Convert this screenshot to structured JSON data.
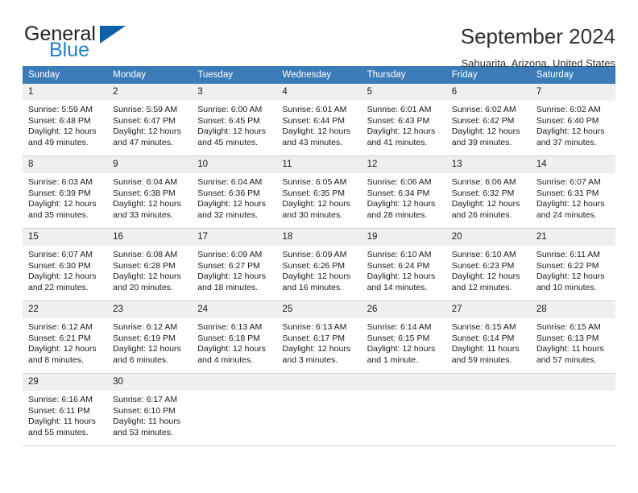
{
  "logo": {
    "word_one": "General",
    "word_two": "Blue",
    "triangle_color": "#1060a8",
    "blue_color": "#1f7fc4"
  },
  "header": {
    "title": "September 2024",
    "subtitle": "Sahuarita, Arizona, United States"
  },
  "theme": {
    "header_bg": "#3b7cb8",
    "header_text": "#ffffff",
    "daynum_bg": "#efefef",
    "cell_border": "#d2d2d2"
  },
  "weekday_headers": [
    "Sunday",
    "Monday",
    "Tuesday",
    "Wednesday",
    "Thursday",
    "Friday",
    "Saturday"
  ],
  "weeks": [
    [
      {
        "day": "1",
        "sunrise": "Sunrise: 5:59 AM",
        "sunset": "Sunset: 6:48 PM",
        "daylight_1": "Daylight: 12 hours",
        "daylight_2": "and 49 minutes."
      },
      {
        "day": "2",
        "sunrise": "Sunrise: 5:59 AM",
        "sunset": "Sunset: 6:47 PM",
        "daylight_1": "Daylight: 12 hours",
        "daylight_2": "and 47 minutes."
      },
      {
        "day": "3",
        "sunrise": "Sunrise: 6:00 AM",
        "sunset": "Sunset: 6:45 PM",
        "daylight_1": "Daylight: 12 hours",
        "daylight_2": "and 45 minutes."
      },
      {
        "day": "4",
        "sunrise": "Sunrise: 6:01 AM",
        "sunset": "Sunset: 6:44 PM",
        "daylight_1": "Daylight: 12 hours",
        "daylight_2": "and 43 minutes."
      },
      {
        "day": "5",
        "sunrise": "Sunrise: 6:01 AM",
        "sunset": "Sunset: 6:43 PM",
        "daylight_1": "Daylight: 12 hours",
        "daylight_2": "and 41 minutes."
      },
      {
        "day": "6",
        "sunrise": "Sunrise: 6:02 AM",
        "sunset": "Sunset: 6:42 PM",
        "daylight_1": "Daylight: 12 hours",
        "daylight_2": "and 39 minutes."
      },
      {
        "day": "7",
        "sunrise": "Sunrise: 6:02 AM",
        "sunset": "Sunset: 6:40 PM",
        "daylight_1": "Daylight: 12 hours",
        "daylight_2": "and 37 minutes."
      }
    ],
    [
      {
        "day": "8",
        "sunrise": "Sunrise: 6:03 AM",
        "sunset": "Sunset: 6:39 PM",
        "daylight_1": "Daylight: 12 hours",
        "daylight_2": "and 35 minutes."
      },
      {
        "day": "9",
        "sunrise": "Sunrise: 6:04 AM",
        "sunset": "Sunset: 6:38 PM",
        "daylight_1": "Daylight: 12 hours",
        "daylight_2": "and 33 minutes."
      },
      {
        "day": "10",
        "sunrise": "Sunrise: 6:04 AM",
        "sunset": "Sunset: 6:36 PM",
        "daylight_1": "Daylight: 12 hours",
        "daylight_2": "and 32 minutes."
      },
      {
        "day": "11",
        "sunrise": "Sunrise: 6:05 AM",
        "sunset": "Sunset: 6:35 PM",
        "daylight_1": "Daylight: 12 hours",
        "daylight_2": "and 30 minutes."
      },
      {
        "day": "12",
        "sunrise": "Sunrise: 6:06 AM",
        "sunset": "Sunset: 6:34 PM",
        "daylight_1": "Daylight: 12 hours",
        "daylight_2": "and 28 minutes."
      },
      {
        "day": "13",
        "sunrise": "Sunrise: 6:06 AM",
        "sunset": "Sunset: 6:32 PM",
        "daylight_1": "Daylight: 12 hours",
        "daylight_2": "and 26 minutes."
      },
      {
        "day": "14",
        "sunrise": "Sunrise: 6:07 AM",
        "sunset": "Sunset: 6:31 PM",
        "daylight_1": "Daylight: 12 hours",
        "daylight_2": "and 24 minutes."
      }
    ],
    [
      {
        "day": "15",
        "sunrise": "Sunrise: 6:07 AM",
        "sunset": "Sunset: 6:30 PM",
        "daylight_1": "Daylight: 12 hours",
        "daylight_2": "and 22 minutes."
      },
      {
        "day": "16",
        "sunrise": "Sunrise: 6:08 AM",
        "sunset": "Sunset: 6:28 PM",
        "daylight_1": "Daylight: 12 hours",
        "daylight_2": "and 20 minutes."
      },
      {
        "day": "17",
        "sunrise": "Sunrise: 6:09 AM",
        "sunset": "Sunset: 6:27 PM",
        "daylight_1": "Daylight: 12 hours",
        "daylight_2": "and 18 minutes."
      },
      {
        "day": "18",
        "sunrise": "Sunrise: 6:09 AM",
        "sunset": "Sunset: 6:26 PM",
        "daylight_1": "Daylight: 12 hours",
        "daylight_2": "and 16 minutes."
      },
      {
        "day": "19",
        "sunrise": "Sunrise: 6:10 AM",
        "sunset": "Sunset: 6:24 PM",
        "daylight_1": "Daylight: 12 hours",
        "daylight_2": "and 14 minutes."
      },
      {
        "day": "20",
        "sunrise": "Sunrise: 6:10 AM",
        "sunset": "Sunset: 6:23 PM",
        "daylight_1": "Daylight: 12 hours",
        "daylight_2": "and 12 minutes."
      },
      {
        "day": "21",
        "sunrise": "Sunrise: 6:11 AM",
        "sunset": "Sunset: 6:22 PM",
        "daylight_1": "Daylight: 12 hours",
        "daylight_2": "and 10 minutes."
      }
    ],
    [
      {
        "day": "22",
        "sunrise": "Sunrise: 6:12 AM",
        "sunset": "Sunset: 6:21 PM",
        "daylight_1": "Daylight: 12 hours",
        "daylight_2": "and 8 minutes."
      },
      {
        "day": "23",
        "sunrise": "Sunrise: 6:12 AM",
        "sunset": "Sunset: 6:19 PM",
        "daylight_1": "Daylight: 12 hours",
        "daylight_2": "and 6 minutes."
      },
      {
        "day": "24",
        "sunrise": "Sunrise: 6:13 AM",
        "sunset": "Sunset: 6:18 PM",
        "daylight_1": "Daylight: 12 hours",
        "daylight_2": "and 4 minutes."
      },
      {
        "day": "25",
        "sunrise": "Sunrise: 6:13 AM",
        "sunset": "Sunset: 6:17 PM",
        "daylight_1": "Daylight: 12 hours",
        "daylight_2": "and 3 minutes."
      },
      {
        "day": "26",
        "sunrise": "Sunrise: 6:14 AM",
        "sunset": "Sunset: 6:15 PM",
        "daylight_1": "Daylight: 12 hours",
        "daylight_2": "and 1 minute."
      },
      {
        "day": "27",
        "sunrise": "Sunrise: 6:15 AM",
        "sunset": "Sunset: 6:14 PM",
        "daylight_1": "Daylight: 11 hours",
        "daylight_2": "and 59 minutes."
      },
      {
        "day": "28",
        "sunrise": "Sunrise: 6:15 AM",
        "sunset": "Sunset: 6:13 PM",
        "daylight_1": "Daylight: 11 hours",
        "daylight_2": "and 57 minutes."
      }
    ],
    [
      {
        "day": "29",
        "sunrise": "Sunrise: 6:16 AM",
        "sunset": "Sunset: 6:11 PM",
        "daylight_1": "Daylight: 11 hours",
        "daylight_2": "and 55 minutes."
      },
      {
        "day": "30",
        "sunrise": "Sunrise: 6:17 AM",
        "sunset": "Sunset: 6:10 PM",
        "daylight_1": "Daylight: 11 hours",
        "daylight_2": "and 53 minutes."
      },
      {
        "day": "",
        "sunrise": "",
        "sunset": "",
        "daylight_1": "",
        "daylight_2": ""
      },
      {
        "day": "",
        "sunrise": "",
        "sunset": "",
        "daylight_1": "",
        "daylight_2": ""
      },
      {
        "day": "",
        "sunrise": "",
        "sunset": "",
        "daylight_1": "",
        "daylight_2": ""
      },
      {
        "day": "",
        "sunrise": "",
        "sunset": "",
        "daylight_1": "",
        "daylight_2": ""
      },
      {
        "day": "",
        "sunrise": "",
        "sunset": "",
        "daylight_1": "",
        "daylight_2": ""
      }
    ]
  ]
}
